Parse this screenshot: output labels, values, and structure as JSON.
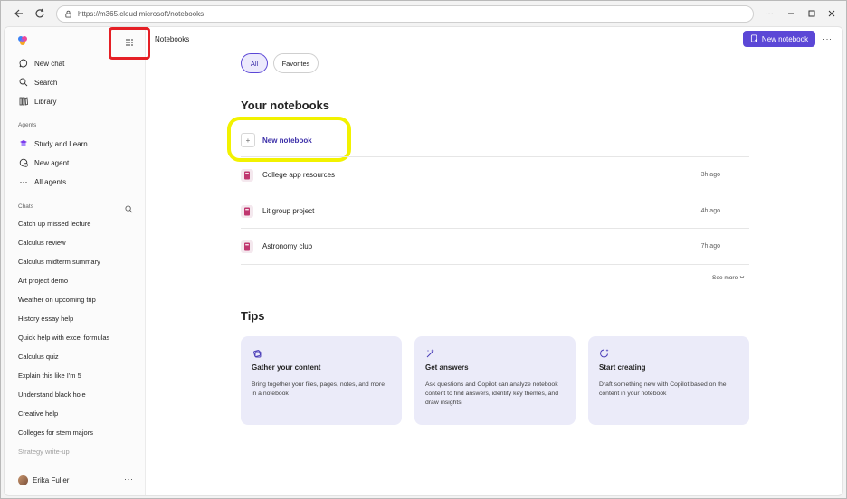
{
  "browser": {
    "url": "https://m365.cloud.microsoft/notebooks"
  },
  "sidebar": {
    "nav": [
      {
        "label": "New chat",
        "icon": "chat-icon"
      },
      {
        "label": "Search",
        "icon": "search-icon"
      },
      {
        "label": "Library",
        "icon": "library-icon"
      }
    ],
    "agents_label": "Agents",
    "agents": [
      {
        "label": "Study and Learn",
        "icon": "study-agent-icon"
      },
      {
        "label": "New agent",
        "icon": "new-agent-icon"
      },
      {
        "label": "All agents",
        "icon": "more-dots-icon"
      }
    ],
    "chats_label": "Chats",
    "chats": [
      "Catch up missed lecture",
      "Calculus review",
      "Calculus midterm summary",
      "Art project demo",
      "Weather on upcoming trip",
      "History essay help",
      "Quick help with excel formulas",
      "Calculus quiz",
      "Explain this like I'm 5",
      "Understand black hole",
      "Creative help",
      "Colleges for stem majors",
      "Strategy write-up"
    ],
    "user_name": "Erika Fuller"
  },
  "header": {
    "title": "Notebooks",
    "new_notebook_label": "New notebook"
  },
  "filters": {
    "all": "All",
    "favorites": "Favorites"
  },
  "notebooks": {
    "heading": "Your notebooks",
    "new_label": "New notebook",
    "items": [
      {
        "name": "College app resources",
        "time": "3h ago"
      },
      {
        "name": "Lit group project",
        "time": "4h ago"
      },
      {
        "name": "Astronomy club",
        "time": "7h ago"
      }
    ],
    "see_more": "See more"
  },
  "tips": {
    "heading": "Tips",
    "cards": [
      {
        "title": "Gather your content",
        "body": "Bring together your files, pages, notes, and more in a notebook",
        "icon": "stack-icon"
      },
      {
        "title": "Get answers",
        "body": "Ask questions and Copilot can analyze notebook content to find answers, identify key themes, and draw insights",
        "icon": "sparkle-pen-icon"
      },
      {
        "title": "Start creating",
        "body": "Draft something new with Copilot based on the content in your notebook",
        "icon": "refresh-sparkle-icon"
      }
    ]
  },
  "colors": {
    "accent": "#5b47d6",
    "highlight_red": "#e51f25",
    "highlight_yellow": "#f2f200",
    "tip_bg": "#ebebf9"
  }
}
